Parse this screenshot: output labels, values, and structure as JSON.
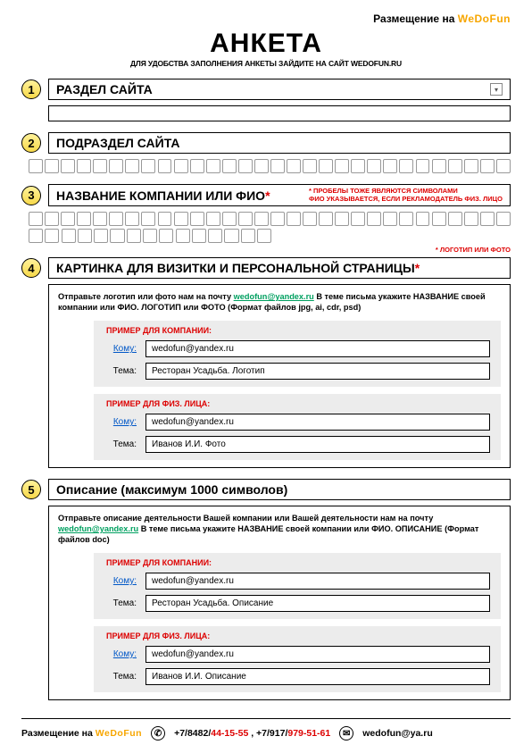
{
  "header": {
    "placement_label": "Размещение на",
    "brand": "WeDoFun",
    "title": "Анкета",
    "subtitle": "для удобства заполнения анкеты зайдите на сайт WeDoFun.ru"
  },
  "sections": {
    "s1": {
      "num": "1",
      "label": "Раздел сайта"
    },
    "s2": {
      "num": "2",
      "label": "Подраздел сайта"
    },
    "s3": {
      "num": "3",
      "label": "Название компании или ФИО",
      "note_line1": "* ПРОБЕЛЫ ТОЖЕ ЯВЛЯЮТСЯ СИМВОЛАМИ",
      "note_line2": "ФИО УКАЗЫВАЕТСЯ, ЕСЛИ РЕКЛАМОДАТЕЛЬ ФИЗ. ЛИЦО",
      "right_note": "* ЛОГОТИП ИЛИ ФОТО"
    },
    "s4": {
      "num": "4",
      "label": "Картинка для визитки и персональной страницы",
      "instr_pre": "Отправьте логотип или фото нам на почту ",
      "email": "wedofun@yandex.ru",
      "instr_post": " В теме письма укажите НАЗВАНИЕ своей компании или ФИО. ЛОГОТИП или ФОТО (Формат файлов jpg, ai, cdr, psd)",
      "example_company_title": "ПРИМЕР ДЛЯ КОМПАНИИ:",
      "example_person_title": "ПРИМЕР ДЛЯ ФИЗ. ЛИЦА:",
      "to_label": "Кому:",
      "subj_label": "Тема:",
      "company_to": "wedofun@yandex.ru",
      "company_subj": "Ресторан Усадьба. Логотип",
      "person_to": "wedofun@yandex.ru",
      "person_subj": "Иванов И.И. Фото"
    },
    "s5": {
      "num": "5",
      "label": "Описание (максимум 1000 символов)",
      "instr_pre": "Отправьте описание деятельности Вашей компании или Вашей деятельности нам на почту ",
      "email": "wedofun@yandex.ru",
      "instr_post": " В теме письма укажите НАЗВАНИЕ своей компании или ФИО. ОПИСАНИЕ (Формат файлов doc)",
      "example_company_title": "ПРИМЕР ДЛЯ КОМПАНИИ:",
      "example_person_title": "ПРИМЕР ДЛЯ ФИЗ. ЛИЦА:",
      "to_label": "Кому:",
      "subj_label": "Тема:",
      "company_to": "wedofun@yandex.ru",
      "company_subj": "Ресторан Усадьба. Описание",
      "person_to": "wedofun@yandex.ru",
      "person_subj": "Иванов И.И. Описание"
    }
  },
  "footer": {
    "placement_label": "Размещение на",
    "brand": "WeDoFun",
    "phone_prefix1": "+7/8482/",
    "phone_red1": "44-15-55",
    "phone_mid": " , +7/917/",
    "phone_red2": "979-51-61",
    "email": "wedofun@ya.ru"
  }
}
